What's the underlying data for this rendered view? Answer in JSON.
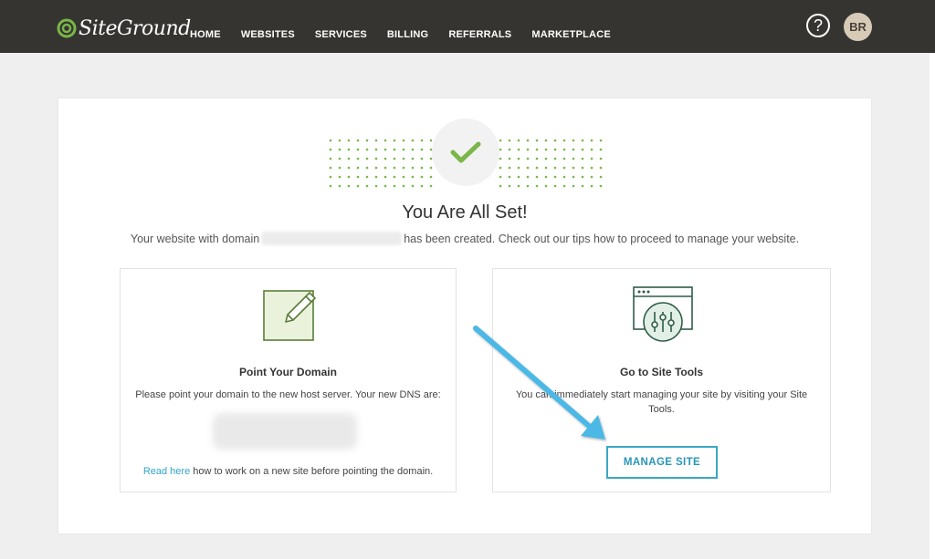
{
  "header": {
    "logo_text": "SiteGround",
    "nav": [
      "HOME",
      "WEBSITES",
      "SERVICES",
      "BILLING",
      "REFERRALS",
      "MARKETPLACE"
    ],
    "help_label": "?",
    "avatar_initials": "BR"
  },
  "main": {
    "title": "You Are All Set!",
    "subtitle_before": "Your website with domain",
    "subtitle_after": "has been created. Check out our tips how to proceed to manage your website."
  },
  "point_domain": {
    "title": "Point Your Domain",
    "text": "Please point your domain to the new host server. Your new DNS are:",
    "link_text": "Read here",
    "footer_text": " how to work on a new site before pointing the domain."
  },
  "site_tools": {
    "title": "Go to Site Tools",
    "text": "You can immediately start managing your site by visiting your Site Tools.",
    "button_label": "MANAGE SITE"
  },
  "colors": {
    "topbar": "#363431",
    "brand_green": "#7ab648",
    "accent_blue": "#3aa7c4",
    "arrow_blue": "#4bb8e6"
  }
}
